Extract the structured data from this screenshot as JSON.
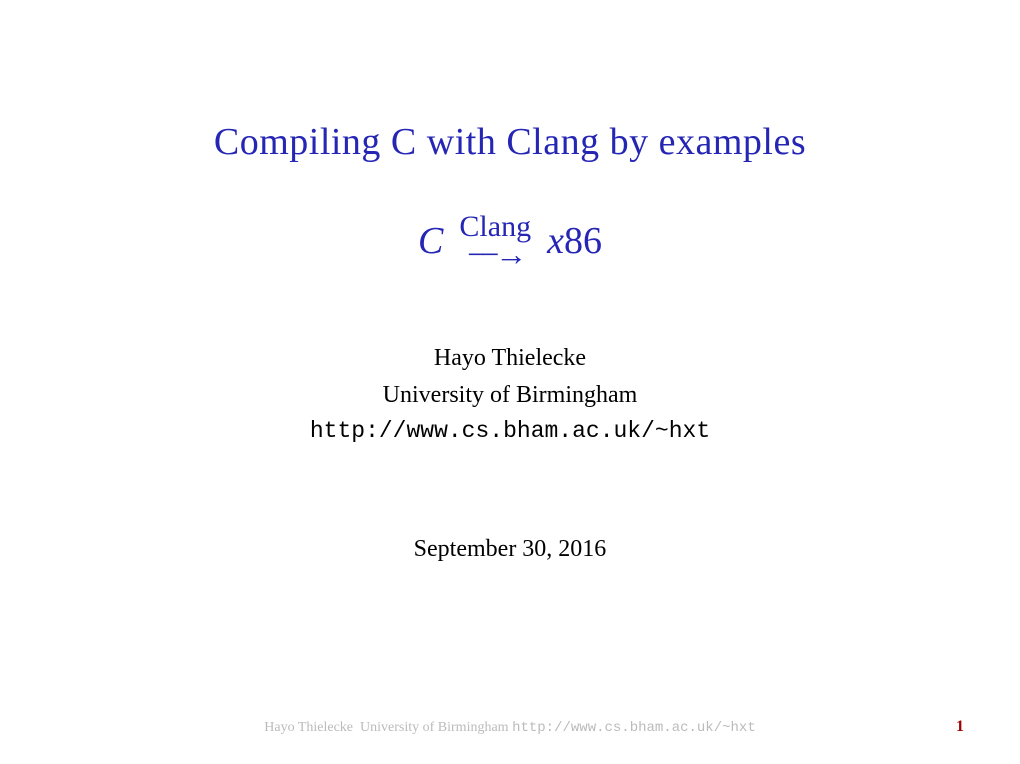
{
  "title": "Compiling C with Clang by examples",
  "formula": {
    "left": "C",
    "arrow_label": "Clang",
    "right_x": "x",
    "right_n": "86"
  },
  "author": {
    "name": "Hayo Thielecke",
    "affiliation": "University of Birmingham",
    "url": "http://www.cs.bham.ac.uk/~hxt"
  },
  "date": "September 30, 2016",
  "footer": {
    "author": "Hayo Thielecke",
    "affiliation": "University of Birmingham",
    "url": "http://www.cs.bham.ac.uk/~hxt"
  },
  "page": "1"
}
